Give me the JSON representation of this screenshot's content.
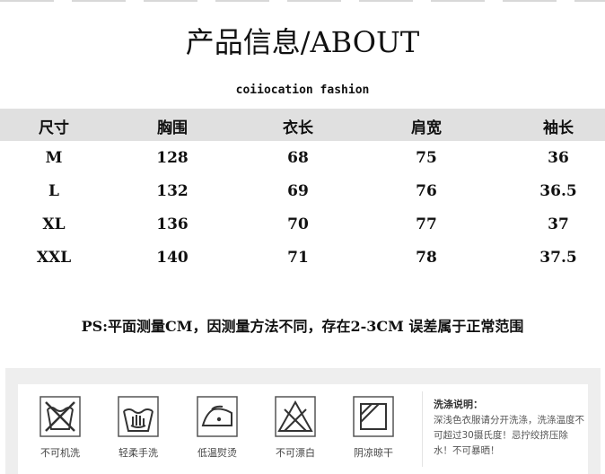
{
  "header": {
    "title": "产品信息/ABOUT",
    "subtitle": "coiiocation fashion"
  },
  "size_table": {
    "columns": [
      "尺寸",
      "胸围",
      "衣长",
      "肩宽",
      "袖长"
    ],
    "rows": [
      [
        "M",
        "128",
        "68",
        "75",
        "36"
      ],
      [
        "L",
        "132",
        "69",
        "76",
        "36.5"
      ],
      [
        "XL",
        "136",
        "70",
        "77",
        "37"
      ],
      [
        "XXL",
        "140",
        "71",
        "78",
        "37.5"
      ]
    ]
  },
  "note": "PS:平面测量CM，因测量方法不同，存在2-3CM 误差属于正常范围",
  "care": {
    "icons": [
      {
        "icon": "no-machine-wash-icon",
        "label": "不可机洗"
      },
      {
        "icon": "gentle-hand-wash-icon",
        "label": "轻柔手洗"
      },
      {
        "icon": "low-temp-iron-icon",
        "label": "低温熨烫"
      },
      {
        "icon": "no-bleach-icon",
        "label": "不可漂白"
      },
      {
        "icon": "shade-dry-icon",
        "label": "阴凉晾干"
      }
    ],
    "wash_title": "洗涤说明：",
    "wash_text": "深浅色衣服请分开洗涤，洗涤温度不可超过30摄氏度！忌拧绞挤压除水！不可暴晒！"
  }
}
